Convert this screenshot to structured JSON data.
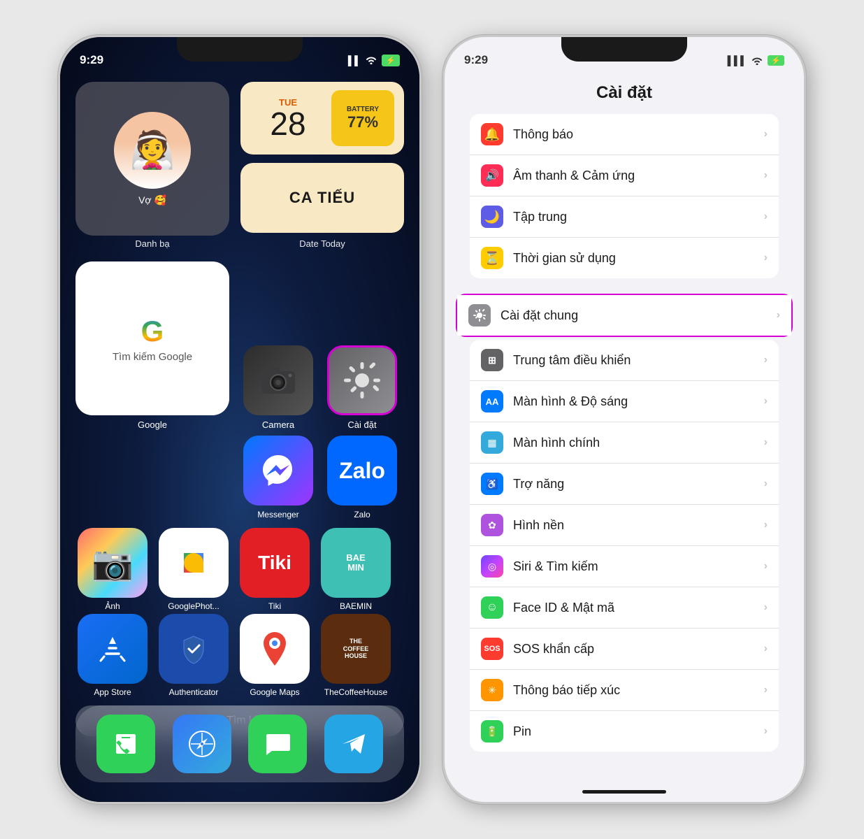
{
  "phone_left": {
    "status_bar": {
      "time": "9:29",
      "signal": "▌▌",
      "wifi": "wifi",
      "battery": "⚡"
    },
    "widgets": {
      "contact_widget_label": "Danh bạ",
      "contact_name": "Vợ 🥰",
      "date_widget_label": "Date Today",
      "date_day": "TUE",
      "date_num": "28",
      "battery_label": "BATTERY",
      "battery_pct": "77%",
      "schedule": "CA TIẾU"
    },
    "apps_row1": [
      {
        "name": "Google",
        "label": "Google"
      },
      {
        "name": "Camera",
        "label": "Camera"
      },
      {
        "name": "Cài đặt",
        "label": "Cài đặt"
      }
    ],
    "apps_row2": [
      {
        "name": "Messenger",
        "label": "Messenger"
      },
      {
        "name": "Zalo",
        "label": "Zalo"
      }
    ],
    "apps_grid": [
      {
        "name": "Ảnh",
        "label": "Ảnh"
      },
      {
        "name": "GooglePhot...",
        "label": "GooglePhot..."
      },
      {
        "name": "Tiki",
        "label": "Tiki"
      },
      {
        "name": "BAEMIN",
        "label": "BAEMIN"
      },
      {
        "name": "App Store",
        "label": "App Store"
      },
      {
        "name": "Authenticator",
        "label": "Authenticator"
      },
      {
        "name": "Google Maps",
        "label": "Google Maps"
      },
      {
        "name": "TheCoffeeHouse",
        "label": "TheCoffeeHouse"
      }
    ],
    "search_bar_text": "Tìm kiếm",
    "dock": [
      {
        "name": "Phone",
        "label": ""
      },
      {
        "name": "Safari",
        "label": ""
      },
      {
        "name": "Messages",
        "label": ""
      },
      {
        "name": "Telegram",
        "label": ""
      }
    ]
  },
  "phone_right": {
    "status_bar": {
      "time": "9:29"
    },
    "title": "Cài đặt",
    "settings_items": [
      {
        "id": "notifications",
        "icon": "🔔",
        "icon_color": "s-red",
        "label": "Thông báo",
        "highlighted": false
      },
      {
        "id": "sound",
        "icon": "🔊",
        "icon_color": "s-pink",
        "label": "Âm thanh & Cảm ứng",
        "highlighted": false
      },
      {
        "id": "focus",
        "icon": "🌙",
        "icon_color": "s-indigo",
        "label": "Tập trung",
        "highlighted": false
      },
      {
        "id": "screentime",
        "icon": "⏳",
        "icon_color": "s-yellow",
        "label": "Thời gian sử dụng",
        "highlighted": false
      },
      {
        "id": "general",
        "icon": "⚙️",
        "icon_color": "s-gray",
        "label": "Cài đặt chung",
        "highlighted": true
      },
      {
        "id": "controlcenter",
        "icon": "⊞",
        "icon_color": "s-gray",
        "label": "Trung tâm điều khiển",
        "highlighted": false
      },
      {
        "id": "display",
        "icon": "AA",
        "icon_color": "s-blue",
        "label": "Màn hình & Độ sáng",
        "highlighted": false
      },
      {
        "id": "homescreen",
        "icon": "▦",
        "icon_color": "s-lblue",
        "label": "Màn hình chính",
        "highlighted": false
      },
      {
        "id": "accessibility",
        "icon": "♿",
        "icon_color": "s-blue",
        "label": "Trợ năng",
        "highlighted": false
      },
      {
        "id": "wallpaper",
        "icon": "✿",
        "icon_color": "s-purple",
        "label": "Hình nền",
        "highlighted": false
      },
      {
        "id": "siri",
        "icon": "◎",
        "icon_color": "s-teal",
        "label": "Siri & Tìm kiếm",
        "highlighted": false
      },
      {
        "id": "faceid",
        "icon": "☺",
        "icon_color": "s-green",
        "label": "Face ID & Mật mã",
        "highlighted": false
      },
      {
        "id": "sos",
        "icon": "SOS",
        "icon_color": "s-red",
        "label": "SOS khẩn cấp",
        "highlighted": false
      },
      {
        "id": "exposurenotif",
        "icon": "✳",
        "icon_color": "s-orange",
        "label": "Thông báo tiếp xúc",
        "highlighted": false
      },
      {
        "id": "battery",
        "icon": "▬",
        "icon_color": "s-green",
        "label": "Pin",
        "highlighted": false
      }
    ]
  },
  "icons": {
    "chevron": "›",
    "search": "🔍",
    "signal_bars": "▌▌▌",
    "wifi_symbol": "⌬",
    "battery_symbol": "⚡"
  }
}
